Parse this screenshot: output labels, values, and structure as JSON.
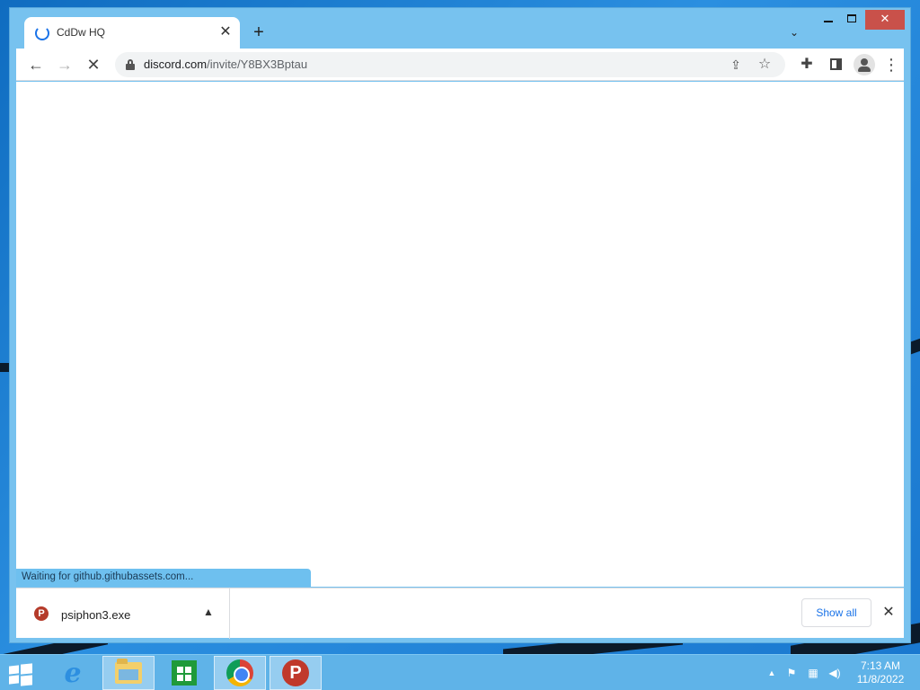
{
  "browser": {
    "tab": {
      "title": "CdDw HQ"
    },
    "url": {
      "host": "discord.com",
      "path": "/invite/Y8BX3Bptau"
    },
    "status_text": "Waiting for github.githubassets.com..."
  },
  "download_shelf": {
    "items": [
      {
        "name": "psiphon3.exe",
        "icon": "psiphon-icon"
      }
    ],
    "show_all_label": "Show all"
  },
  "taskbar": {
    "apps": [
      "internet-explorer",
      "file-explorer",
      "store",
      "chrome",
      "psiphon"
    ],
    "active_app": "chrome",
    "clock": {
      "time": "7:13 AM",
      "date": "11/8/2022"
    }
  },
  "colors": {
    "accent": "#1a73e8",
    "status_bubble": "#6ec0ef",
    "window_frame": "#77c2ef",
    "close_button": "#c9514a",
    "taskbar": "#5fb3e8"
  }
}
